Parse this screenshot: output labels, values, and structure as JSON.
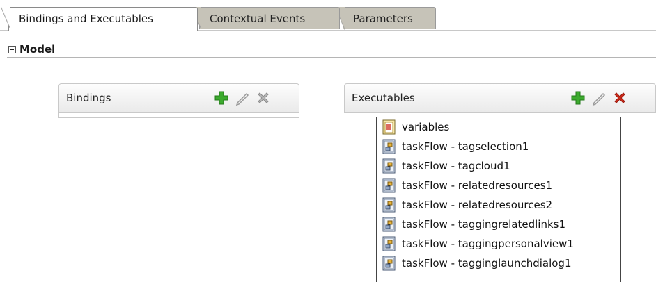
{
  "tabs": [
    {
      "label": "Bindings and Executables",
      "active": true
    },
    {
      "label": "Contextual Events",
      "active": false
    },
    {
      "label": "Parameters",
      "active": false
    }
  ],
  "section": {
    "label": "Model"
  },
  "bindings_panel": {
    "title": "Bindings",
    "tools": [
      "add-icon",
      "edit-icon",
      "delete-icon"
    ],
    "items": []
  },
  "executables_panel": {
    "title": "Executables",
    "tools": [
      "add-icon",
      "edit-icon",
      "delete-icon"
    ],
    "items": [
      {
        "label": "variables",
        "icon": "variables-icon"
      },
      {
        "label": "taskFlow - tagselection1",
        "icon": "taskflow-icon"
      },
      {
        "label": "taskFlow - tagcloud1",
        "icon": "taskflow-icon"
      },
      {
        "label": "taskFlow - relatedresources1",
        "icon": "taskflow-icon"
      },
      {
        "label": "taskFlow - relatedresources2",
        "icon": "taskflow-icon"
      },
      {
        "label": "taskFlow - taggingrelatedlinks1",
        "icon": "taskflow-icon"
      },
      {
        "label": "taskFlow - taggingpersonalview1",
        "icon": "taskflow-icon"
      },
      {
        "label": "taskFlow - tagginglaunchdialog1",
        "icon": "taskflow-icon"
      }
    ]
  },
  "colors": {
    "add": "#3cab2e",
    "delete_active": "#d02a1a",
    "delete_disabled": "#a9a9a9",
    "edit": "#9a9a9a",
    "inactive_tab": "#c6c3b8"
  }
}
